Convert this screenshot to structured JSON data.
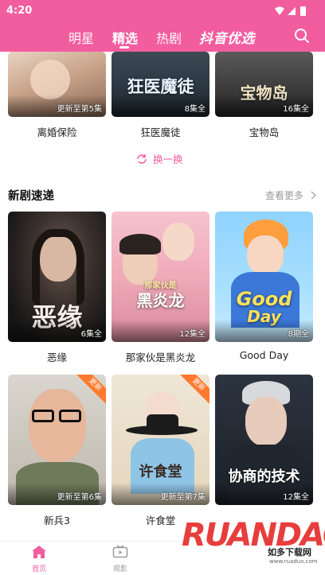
{
  "status": {
    "time": "4:20"
  },
  "header": {
    "tabs": [
      {
        "label": "明星"
      },
      {
        "label": "精选"
      },
      {
        "label": "热剧"
      }
    ],
    "brand": "抖音优选",
    "accent": "#f25da0"
  },
  "row1": [
    {
      "title": "离婚保险",
      "episodes": "更新至第5集"
    },
    {
      "title": "狂医魔徒",
      "poster_text": "狂医魔徒",
      "episodes": "8集全"
    },
    {
      "title": "宝物岛",
      "poster_text": "宝物岛",
      "episodes": "16集全"
    }
  ],
  "refresh_label": "换一换",
  "new_section": {
    "title": "新剧速递",
    "more": "查看更多"
  },
  "row2": [
    {
      "title": "恶缘",
      "poster_text": "恶缘",
      "episodes": "6集全"
    },
    {
      "title": "那家伙是黑炎龙",
      "poster_text": "那家伙是黑炎龙",
      "poster_small": "那家伙是",
      "poster_large": "黑炎龙",
      "episodes": "12集全"
    },
    {
      "title": "Good Day",
      "poster_text_1": "Good",
      "poster_text_2": "Day",
      "episodes": "8期全"
    }
  ],
  "row3": [
    {
      "title": "新兵3",
      "episodes": "更新至第6集",
      "badge": "更新"
    },
    {
      "title": "许食堂",
      "poster_text": "许食堂",
      "episodes": "更新至第7集",
      "badge": "更新"
    },
    {
      "title": "协商的技术",
      "poster_text": "协商的技术",
      "episodes": "12集全"
    }
  ],
  "bottom_nav": [
    {
      "label": "首页",
      "icon": "home-icon"
    },
    {
      "label": "观影",
      "icon": "tv-icon"
    }
  ],
  "watermark": {
    "big": "RUANDAO",
    "small": "如多下载网",
    "url": "www.ruaduo.com"
  }
}
